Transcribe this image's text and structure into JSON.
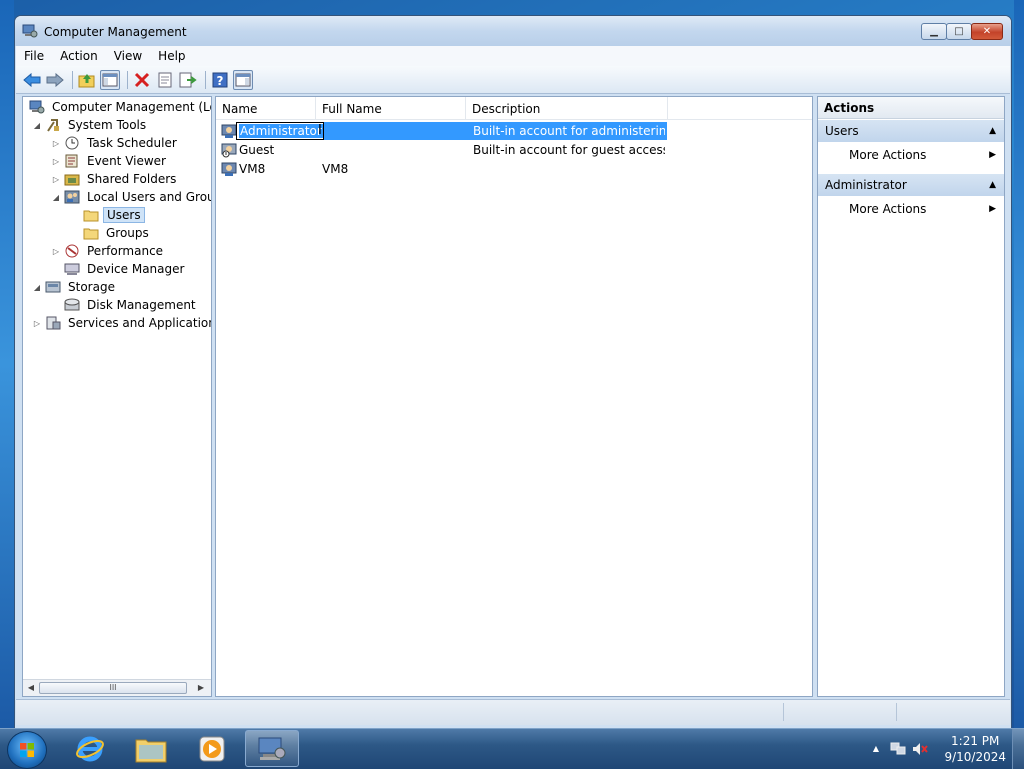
{
  "window": {
    "title": "Computer Management",
    "minimize_glyph": "▁",
    "maximize_glyph": "□",
    "close_glyph": "✕"
  },
  "menubar": {
    "items": [
      "File",
      "Action",
      "View",
      "Help"
    ]
  },
  "toolbar": {
    "icons": [
      "back-arrow-icon",
      "forward-arrow-icon",
      "up-folder-icon",
      "show-hide-tree-icon",
      "delete-icon",
      "properties-icon",
      "export-list-icon",
      "help-icon",
      "show-hide-action-pane-icon"
    ]
  },
  "tree": {
    "items": [
      {
        "label": "Computer Management (Local",
        "icon": "computer-management-icon",
        "expander": ""
      },
      {
        "label": "System Tools",
        "icon": "system-tools-icon",
        "expander": "◢"
      },
      {
        "label": "Task Scheduler",
        "icon": "task-scheduler-icon",
        "expander": "▷"
      },
      {
        "label": "Event Viewer",
        "icon": "event-viewer-icon",
        "expander": "▷"
      },
      {
        "label": "Shared Folders",
        "icon": "shared-folders-icon",
        "expander": "▷"
      },
      {
        "label": "Local Users and Groups",
        "icon": "local-users-groups-icon",
        "expander": "◢"
      },
      {
        "label": "Users",
        "icon": "folder-icon",
        "expander": ""
      },
      {
        "label": "Groups",
        "icon": "folder-icon",
        "expander": ""
      },
      {
        "label": "Performance",
        "icon": "performance-icon",
        "expander": "▷"
      },
      {
        "label": "Device Manager",
        "icon": "device-manager-icon",
        "expander": ""
      },
      {
        "label": "Storage",
        "icon": "storage-icon",
        "expander": "◢"
      },
      {
        "label": "Disk Management",
        "icon": "disk-management-icon",
        "expander": ""
      },
      {
        "label": "Services and Applications",
        "icon": "services-applications-icon",
        "expander": "▷"
      }
    ],
    "selected": "Users",
    "scroll_thumb_glyph": "III",
    "scroll_left_glyph": "◀",
    "scroll_right_glyph": "▶"
  },
  "list": {
    "columns": [
      "Name",
      "Full Name",
      "Description"
    ],
    "rows": [
      {
        "name": "Administrator",
        "full_name": "",
        "description": "Built-in account for administering...",
        "selected": true,
        "editing": true
      },
      {
        "name": "Guest",
        "full_name": "",
        "description": "Built-in account for guest access t...",
        "selected": false,
        "editing": false
      },
      {
        "name": "VM8",
        "full_name": "VM8",
        "description": "",
        "selected": false,
        "editing": false
      }
    ]
  },
  "actions": {
    "title": "Actions",
    "sections": [
      {
        "label": "Users",
        "items": [
          "More Actions"
        ]
      },
      {
        "label": "Administrator",
        "items": [
          "More Actions"
        ]
      }
    ],
    "collapse_glyph": "▲",
    "submenu_glyph": "▶"
  },
  "taskbar": {
    "pinned": [
      "internet-explorer-icon",
      "windows-explorer-icon",
      "media-player-icon",
      "computer-management-task-icon"
    ],
    "clock_time": "1:21 PM",
    "clock_date": "9/10/2024",
    "tray_arrow_glyph": "▲"
  },
  "colors": {
    "selection": "#3399ff",
    "tree_selection": "#cfe3f7",
    "window_frame": "#cfe0f2"
  }
}
